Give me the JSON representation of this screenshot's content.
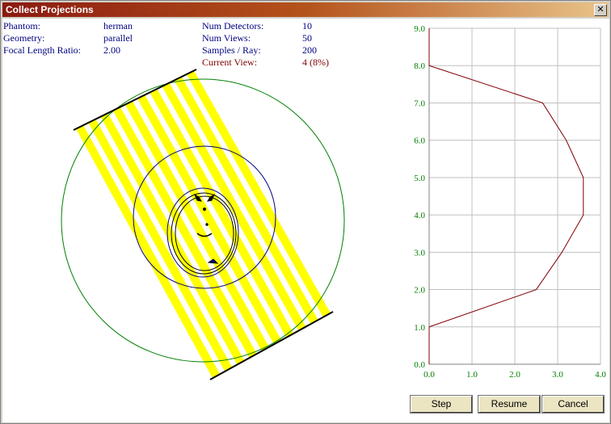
{
  "window": {
    "title": "Collect Projections",
    "close_glyph": "✕"
  },
  "info": {
    "phantom_label": "Phantom:",
    "phantom_value": "herman",
    "geometry_label": "Geometry:",
    "geometry_value": "parallel",
    "focal_label": "Focal Length Ratio:",
    "focal_value": "2.00",
    "detectors_label": "Num Detectors:",
    "detectors_value": "10",
    "views_label": "Num Views:",
    "views_value": "50",
    "samples_label": "Samples / Ray:",
    "samples_value": "200",
    "current_label": "Current View:",
    "current_value": "4 (8%)"
  },
  "buttons": {
    "step": "Step",
    "resume": "Resume",
    "cancel": "Cancel"
  },
  "colors": {
    "rays": "#ffff00",
    "circle": "#008000",
    "phantom": "#000080",
    "plot_line": "#800000",
    "tick_text": "#008000",
    "grid": "#c0c0c0"
  },
  "chart_data": {
    "type": "line",
    "orientation": "horizontal",
    "x": [
      0.0,
      0.0,
      2.5,
      3.1,
      3.6,
      3.6,
      3.2,
      2.65,
      0.0,
      0.0
    ],
    "y": [
      0.0,
      1.0,
      2.0,
      3.0,
      4.0,
      5.0,
      6.0,
      7.0,
      8.0,
      9.0
    ],
    "xlim": [
      0.0,
      4.0
    ],
    "ylim": [
      0.0,
      9.0
    ],
    "xticks": [
      "0.0",
      "1.0",
      "2.0",
      "3.0",
      "4.0"
    ],
    "yticks": [
      "0.0",
      "1.0",
      "2.0",
      "3.0",
      "4.0",
      "5.0",
      "6.0",
      "7.0",
      "8.0",
      "9.0"
    ],
    "grid": true
  }
}
